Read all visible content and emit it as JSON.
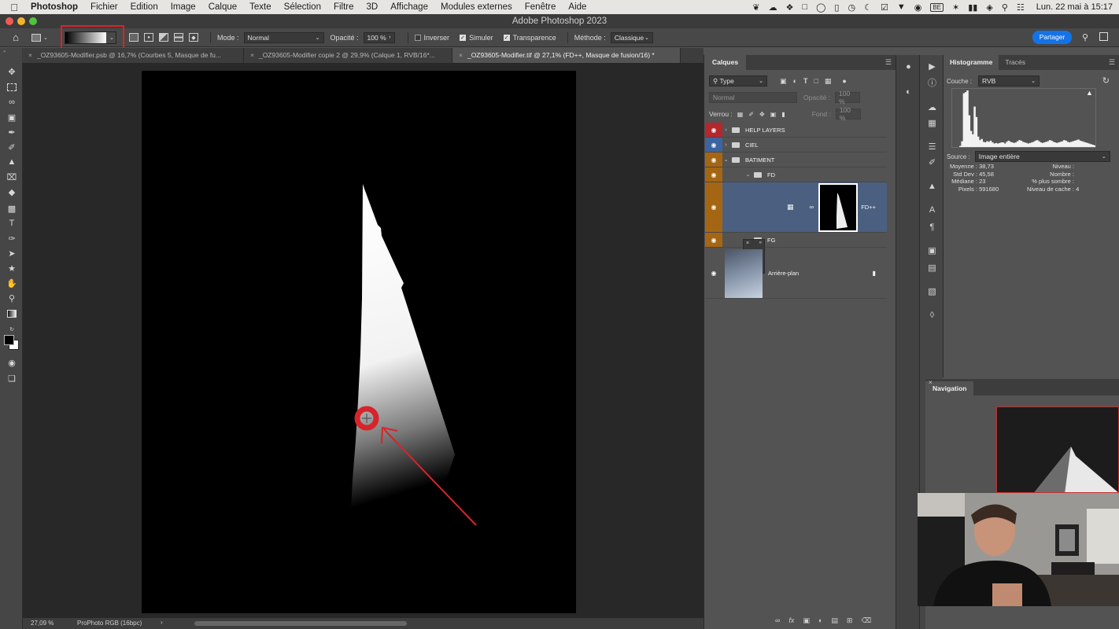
{
  "menubar": {
    "app_name": "Photoshop",
    "items": [
      "Fichier",
      "Edition",
      "Image",
      "Calque",
      "Texte",
      "Sélection",
      "Filtre",
      "3D",
      "Affichage",
      "Modules externes",
      "Fenêtre",
      "Aide"
    ],
    "keyboard_layout": "BE",
    "clock": "Lun. 22 mai à 15:17"
  },
  "window": {
    "title": "Adobe Photoshop 2023"
  },
  "options_bar": {
    "mode_label": "Mode :",
    "mode_value": "Normal",
    "opacity_label": "Opacité :",
    "opacity_value": "100 %",
    "inverser_label": "Inverser",
    "simuler_label": "Simuler",
    "transparence_label": "Transparence",
    "methode_label": "Méthode :",
    "methode_value": "Classique",
    "share_label": "Partager",
    "inverser_checked": false,
    "simuler_checked": true,
    "transparence_checked": true
  },
  "doc_tabs": [
    {
      "label": "_OZ93605-Modifier.psb @ 16,7% (Courbes 5, Masque de fu...",
      "active": false
    },
    {
      "label": "_OZ93605-Modifier copie 2 @ 29,9% (Calque 1, RVB/16*...",
      "active": false
    },
    {
      "label": "_OZ93605-Modifier.tif @ 27,1% (FD++, Masque de fusion/16) *",
      "active": true
    }
  ],
  "status_bar": {
    "zoom": "27,09 %",
    "profile": "ProPhoto RGB (16bpc)"
  },
  "layers_panel": {
    "title": "Calques",
    "filter_value": "Type",
    "blend_mode": "Normal",
    "opacity_label": "Opacité :",
    "opacity_value": "100 %",
    "lock_label": "Verrou :",
    "fill_label": "Fond :",
    "fill_value": "100 %",
    "layers": [
      {
        "name": "HELP LAYERS",
        "color": "#b5272c"
      },
      {
        "name": "CIEL",
        "color": "#3c64a0"
      },
      {
        "name": "BATIMENT",
        "color": "#a56614"
      },
      {
        "name": "FD",
        "color": "#a56614"
      },
      {
        "name": "FD++",
        "color": "#a56614"
      },
      {
        "name": "FG",
        "color": "#a56614"
      },
      {
        "name": "Arrière-plan",
        "color": "#535353"
      }
    ]
  },
  "histogram_panel": {
    "tabs": [
      "Histogramme",
      "Tracés"
    ],
    "channel_label": "Couche :",
    "channel_value": "RVB",
    "source_label": "Source :",
    "source_value": "Image entière",
    "stats_left": [
      {
        "label": "Moyenne :",
        "value": "38,73"
      },
      {
        "label": "Std Dev :",
        "value": "45,58"
      },
      {
        "label": "Médiane :",
        "value": "23"
      },
      {
        "label": "Pixels :",
        "value": "591680"
      }
    ],
    "stats_right": [
      {
        "label": "Niveau :",
        "value": ""
      },
      {
        "label": "Nombre :",
        "value": ""
      },
      {
        "label": "% plus sombre :",
        "value": ""
      },
      {
        "label": "Niveau de cache :",
        "value": "4"
      }
    ],
    "bins": [
      0,
      0,
      0,
      0,
      2,
      10,
      93,
      95,
      98,
      55,
      28,
      22,
      70,
      52,
      18,
      12,
      14,
      9,
      8,
      10,
      9,
      11,
      8,
      6,
      7,
      6,
      7,
      8,
      8,
      6,
      9,
      11,
      9,
      8,
      7,
      8,
      10,
      12,
      11,
      9,
      8,
      7,
      6,
      7,
      8,
      9,
      11,
      12,
      10,
      8,
      7,
      8,
      9,
      10,
      12,
      11,
      9,
      8,
      7,
      8,
      9,
      10,
      12,
      11,
      9,
      8,
      9,
      10,
      11,
      12,
      13,
      11,
      10,
      9,
      8,
      7,
      6,
      5,
      4,
      3
    ]
  },
  "navigation_panel": {
    "title": "Navigation"
  }
}
